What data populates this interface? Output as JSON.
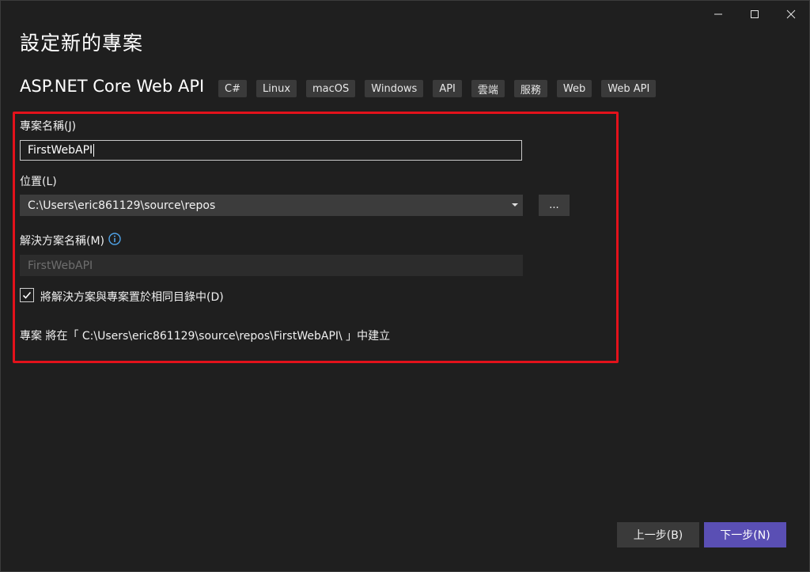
{
  "window": {
    "title": "設定新的專案",
    "controls": {
      "minimize": "minimize-icon",
      "maximize": "maximize-icon",
      "close": "close-icon"
    }
  },
  "template": {
    "name": "ASP.NET Core Web API",
    "tags": [
      "C#",
      "Linux",
      "macOS",
      "Windows",
      "API",
      "雲端",
      "服務",
      "Web",
      "Web API"
    ]
  },
  "form": {
    "project_name_label": "專案名稱(J)",
    "project_name_value": "FirstWebAPI",
    "location_label": "位置(L)",
    "location_value": "C:\\Users\\eric861129\\source\\repos",
    "browse_label": "...",
    "solution_name_label": "解決方案名稱(M)",
    "solution_name_placeholder": "FirstWebAPI",
    "same_directory_checked": true,
    "same_directory_label": "將解決方案與專案置於相同目錄中(D)",
    "path_note": "專案 將在「 C:\\Users\\eric861129\\source\\repos\\FirstWebAPI\\ 」中建立"
  },
  "footer": {
    "back_label": "上一步(B)",
    "next_label": "下一步(N)"
  },
  "colors": {
    "background": "#1f1f1f",
    "highlight_border": "#e3121b",
    "primary_button": "#5a4fb4",
    "info_icon": "#4fa3e8"
  }
}
